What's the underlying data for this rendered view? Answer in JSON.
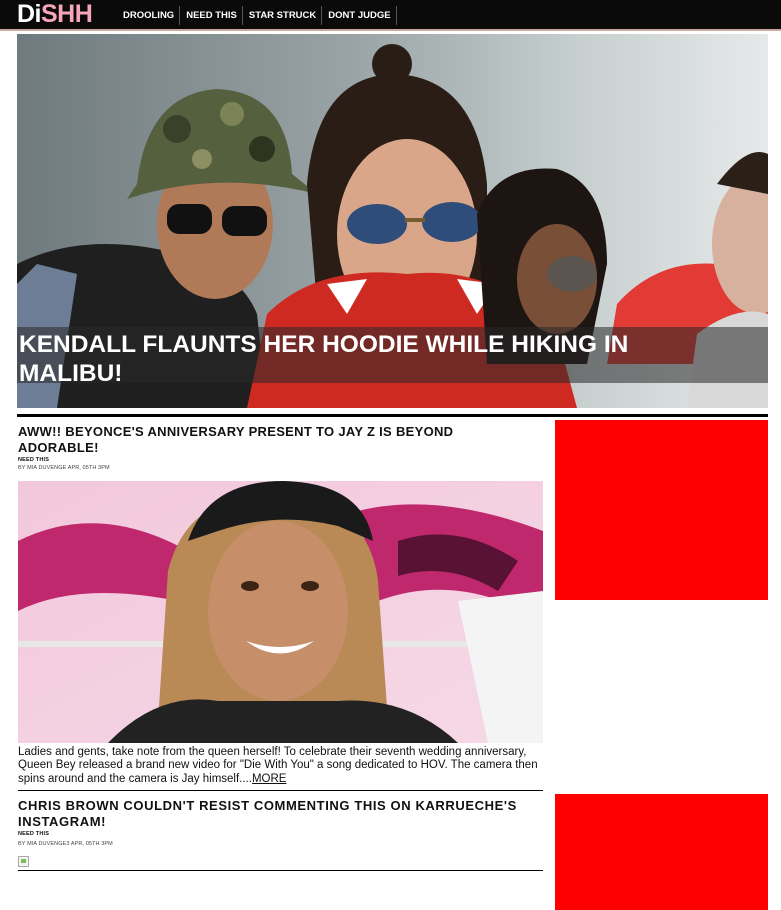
{
  "brand": {
    "logo_part1": "Di",
    "logo_part2": "SHH"
  },
  "nav": [
    {
      "label": "DROOLING"
    },
    {
      "label": "NEED THIS"
    },
    {
      "label": "STAR STRUCK"
    },
    {
      "label": "DONT JUDGE"
    }
  ],
  "hero": {
    "title": "KENDALL FLAUNTS HER HOODIE WHILE HIKING IN MALIBU!"
  },
  "articles": [
    {
      "title": "AWW!! BEYONCE'S ANNIVERSARY PRESENT TO JAY Z IS BEYOND ADORABLE!",
      "category": "NEED THIS",
      "byline": "BY MIA DUVENGE APR, 05TH 3PM",
      "excerpt": "Ladies and gents, take note from the queen herself! To celebrate their seventh wedding anniversary, Queen Bey released a brand new video for \"Die With You\" a song dedicated to HOV. The camera then spins around and the camera is Jay himself....",
      "more": "MORE"
    },
    {
      "title": "CHRIS BROWN COULDN'T RESIST COMMENTING THIS ON KARRUECHE'S INSTAGRAM!",
      "category": "NEED THIS",
      "byline": "BY MIA DUVENGE3 APR, 05TH 3PM"
    }
  ],
  "colors": {
    "accent_pink": "#f6a6b9",
    "ad_red": "#ff0000",
    "topbar": "#0a0a0a"
  }
}
